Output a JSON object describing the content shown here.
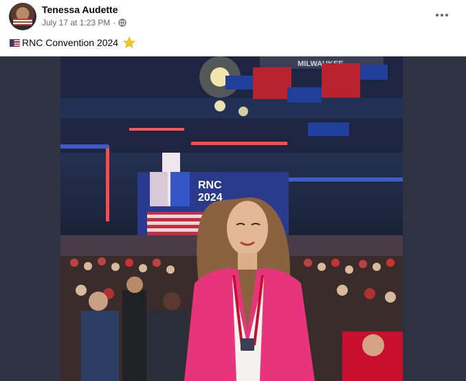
{
  "post": {
    "author": "Tenessa Audette",
    "timestamp": "July 17 at 1:23 PM",
    "audience_icon": "globe-icon",
    "caption_text": "RNC Convention 2024",
    "caption_leading_emoji": "us-flag-emoji",
    "caption_trailing_emoji": "star-emoji",
    "more_options_icon": "more-horizontal-icon"
  },
  "photo": {
    "stage_sign": "RNC\n2024",
    "banner_text": "MILWAUKEE"
  },
  "colors": {
    "author_text": "#050505",
    "meta_text": "#65676b",
    "frame_bg": "#2e3242",
    "jacket": "#e8347d",
    "star_gold": "#f7c325"
  }
}
